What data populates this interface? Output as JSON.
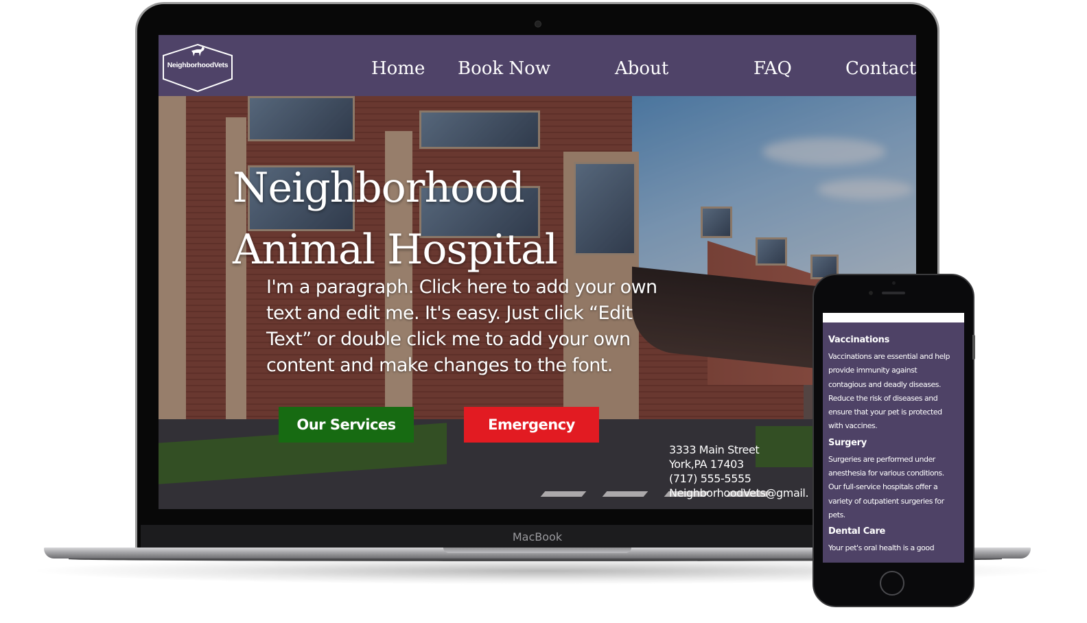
{
  "laptop": {
    "brand_label": "MacBook"
  },
  "site": {
    "logo_text": "NeighborhoodVets",
    "nav": [
      "Home",
      "Book Now",
      "About",
      "FAQ",
      "Contact"
    ],
    "hero": {
      "title_lines": [
        "Neighborhood",
        "Animal Hospital"
      ],
      "paragraph_lines": [
        "I'm a paragraph. Click here to add your own",
        "text and edit me. It's easy. Just click “Edit",
        "Text” or double click me to add your own",
        "content and make changes to the font."
      ],
      "buttons": {
        "services": "Our Services",
        "emergency": "Emergency"
      }
    },
    "address": {
      "street": "3333 Main Street",
      "city": "York,PA 17403",
      "phone": "(717) 555-5555",
      "email": "NeighborhoodVets@gmail."
    },
    "colors": {
      "nav_bg": "#4f4368",
      "services_btn": "#176b12",
      "emergency_btn": "#e21b22"
    }
  },
  "mobile": {
    "sections": [
      {
        "heading": "Vaccinations",
        "lines": [
          "Vaccinations are essential and help",
          "provide immunity against",
          "contagious and deadly diseases.",
          "Reduce the risk of diseases and",
          "ensure that your pet is protected",
          "with vaccines."
        ]
      },
      {
        "heading": "Surgery",
        "lines": [
          "Surgeries are performed under",
          "anesthesia for various conditions.",
          "Our full-service hospitals offer a",
          "variety of outpatient surgeries for",
          "pets."
        ]
      },
      {
        "heading": "Dental Care",
        "lines": [
          "Your pet's oral health is a good"
        ]
      }
    ]
  }
}
